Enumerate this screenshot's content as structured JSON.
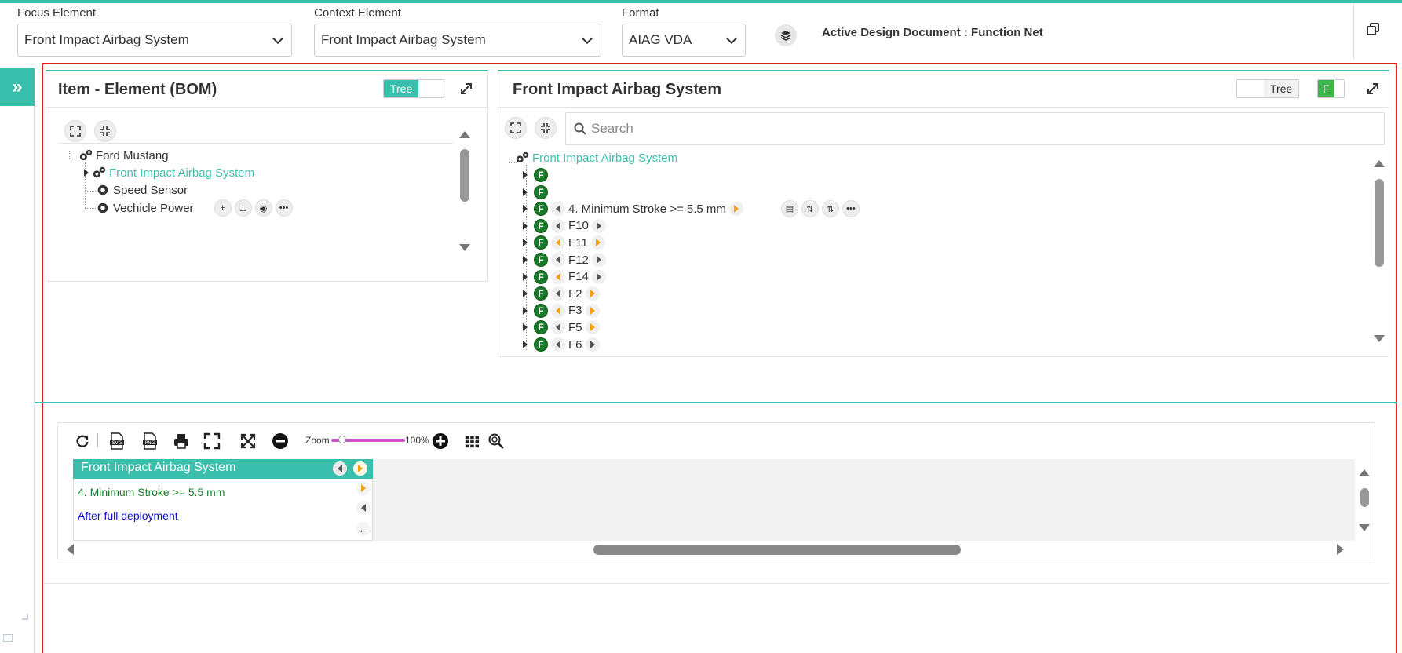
{
  "topbar": {
    "focus_label": "Focus Element",
    "focus_value": "Front Impact Airbag System",
    "context_label": "Context Element",
    "context_value": "Front Impact Airbag System",
    "format_label": "Format",
    "format_value": "AIAG VDA",
    "active_doc": "Active Design Document : Function Net",
    "icons": {
      "layers": "layers-icon",
      "copy": "copy-window-icon"
    }
  },
  "left_rail": {
    "toggle_icon": "double-chevron-right-icon",
    "glyph": "»"
  },
  "bom_panel": {
    "title": "Item - Element (BOM)",
    "toggle_label": "Tree",
    "toggle_on": true,
    "tree": {
      "root": "Ford Mustang",
      "children": [
        {
          "label": "Front Impact Airbag System",
          "selected": true
        },
        {
          "label": "Speed Sensor"
        },
        {
          "label": "Vechicle Power"
        }
      ]
    },
    "row_actions": [
      "add-icon",
      "hierarchy-icon",
      "eye-icon",
      "more-icon"
    ],
    "row_action_glyphs": [
      "+",
      "⊥",
      "◉",
      "•••"
    ]
  },
  "function_panel": {
    "title": "Front Impact Airbag System",
    "toggle_label": "Tree",
    "toggle_on": false,
    "f_toggle_label": "F",
    "search_placeholder": "Search",
    "root": "Front Impact Airbag System",
    "badge": "F",
    "rows": [
      {
        "label": "",
        "left": false,
        "right": false
      },
      {
        "label": "",
        "left": false,
        "right": false
      },
      {
        "label": "4. Minimum Stroke >= 5.5 mm",
        "left": "grey",
        "right": "orange"
      },
      {
        "label": "F10",
        "left": "grey",
        "right": "grey"
      },
      {
        "label": "F11",
        "left": "orange",
        "right": "orange"
      },
      {
        "label": "F12",
        "left": "grey",
        "right": "grey"
      },
      {
        "label": "F14",
        "left": "orange",
        "right": "grey"
      },
      {
        "label": "F2",
        "left": "grey",
        "right": "orange"
      },
      {
        "label": "F3",
        "left": "orange",
        "right": "orange"
      },
      {
        "label": "F5",
        "left": "grey",
        "right": "orange"
      },
      {
        "label": "F6",
        "left": "grey",
        "right": "grey"
      }
    ],
    "row_actions": [
      "clipboard-icon",
      "sort-icon",
      "sort-alt-icon",
      "more-icon"
    ],
    "row_action_glyphs": [
      "▤",
      "⇅",
      "⇅",
      "•••"
    ]
  },
  "diagram": {
    "toolbar": [
      "refresh-icon",
      "export-svg-icon",
      "export-png-icon",
      "print-icon",
      "fit-icon",
      "fullscreen-icon",
      "zoom-out-icon",
      "zoom-in-icon",
      "grid-icon",
      "search-zoom-icon"
    ],
    "zoom_label": "Zoom",
    "zoom_percent": "100%",
    "zoom_fraction": 0.15,
    "card": {
      "title": "Front Impact Airbag System",
      "line1": "4. Minimum Stroke >= 5.5 mm",
      "line2": "After full deployment"
    }
  },
  "colors": {
    "accent": "#3bbfad",
    "frame": "#e02020",
    "badge_green": "#1a7a2a",
    "orange": "#f0a010",
    "zoom_track": "#d050d0",
    "link_blue": "#1010cc"
  }
}
